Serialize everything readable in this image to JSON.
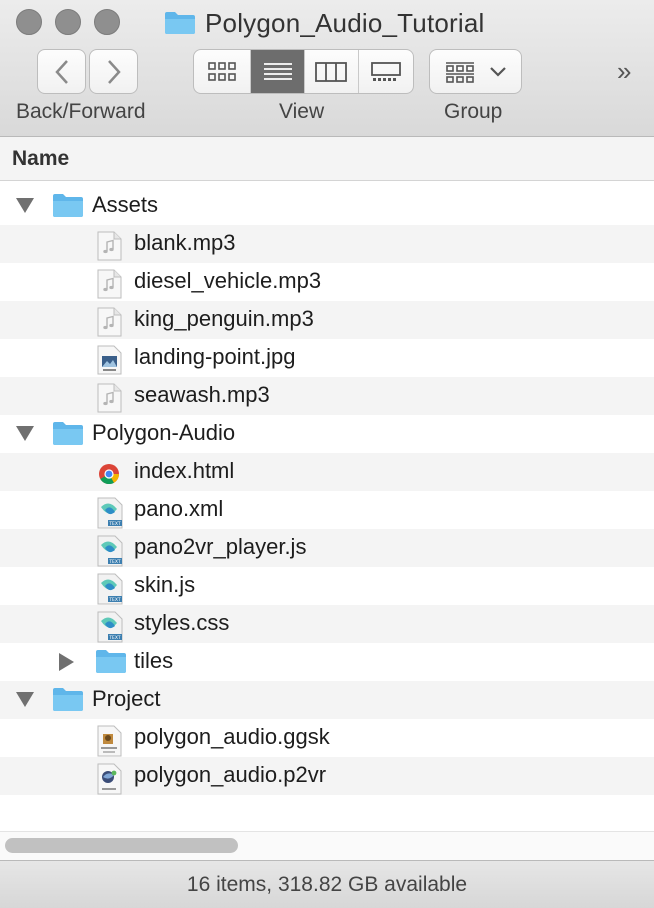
{
  "window": {
    "title": "Polygon_Audio_Tutorial"
  },
  "toolbar": {
    "back_forward_label": "Back/Forward",
    "view_label": "View",
    "group_label": "Group",
    "view_modes": [
      "icons",
      "list",
      "columns",
      "gallery"
    ],
    "active_view": "list",
    "overflow_glyph": "»"
  },
  "column_header": {
    "name": "Name"
  },
  "files": [
    {
      "name": "Assets",
      "kind": "folder",
      "depth": 0,
      "disclosure": "open"
    },
    {
      "name": "blank.mp3",
      "kind": "audio",
      "depth": 1
    },
    {
      "name": "diesel_vehicle.mp3",
      "kind": "audio",
      "depth": 1
    },
    {
      "name": "king_penguin.mp3",
      "kind": "audio",
      "depth": 1
    },
    {
      "name": "landing-point.jpg",
      "kind": "image",
      "depth": 1
    },
    {
      "name": "seawash.mp3",
      "kind": "audio",
      "depth": 1
    },
    {
      "name": "Polygon-Audio",
      "kind": "folder",
      "depth": 0,
      "disclosure": "open"
    },
    {
      "name": "index.html",
      "kind": "chrome-html",
      "depth": 1
    },
    {
      "name": "pano.xml",
      "kind": "text-doc",
      "depth": 1
    },
    {
      "name": "pano2vr_player.js",
      "kind": "text-doc",
      "depth": 1
    },
    {
      "name": "skin.js",
      "kind": "text-doc",
      "depth": 1
    },
    {
      "name": "styles.css",
      "kind": "text-doc",
      "depth": 1
    },
    {
      "name": "tiles",
      "kind": "folder",
      "depth": 1,
      "disclosure": "closed"
    },
    {
      "name": "Project",
      "kind": "folder",
      "depth": 0,
      "disclosure": "open"
    },
    {
      "name": "polygon_audio.ggsk",
      "kind": "ggsk-doc",
      "depth": 1
    },
    {
      "name": "polygon_audio.p2vr",
      "kind": "p2vr-doc",
      "depth": 1
    }
  ],
  "status_bar": {
    "text": "16 items, 318.82 GB available"
  },
  "colors": {
    "folder": "#6ec0ee",
    "selected_segment": "#6d6d6d",
    "row_stripe": "#f4f4f4"
  }
}
